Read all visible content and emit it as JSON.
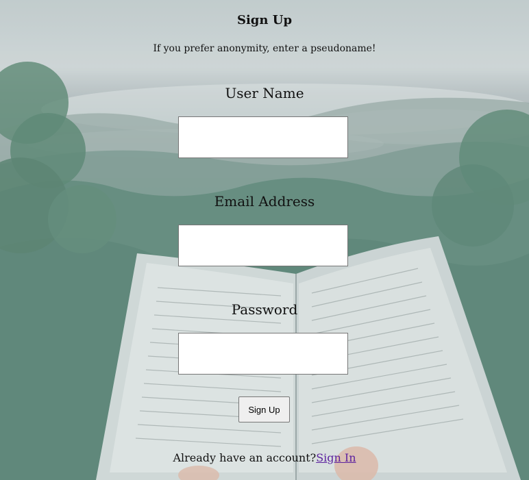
{
  "header": {
    "title": "Sign Up",
    "subtitle": "If you prefer anonymity, enter a pseudoname!"
  },
  "form": {
    "username_label": "User Name",
    "username_value": "",
    "email_label": "Email Address",
    "email_value": "",
    "password_label": "Password",
    "password_value": "",
    "submit_label": "Sign Up"
  },
  "footer": {
    "prompt": "Already have an account?",
    "link_label": "Sign In"
  },
  "colors": {
    "link": "#5b1f9e",
    "forest": "#4c7d6d",
    "sky": "#c7d0d1"
  }
}
